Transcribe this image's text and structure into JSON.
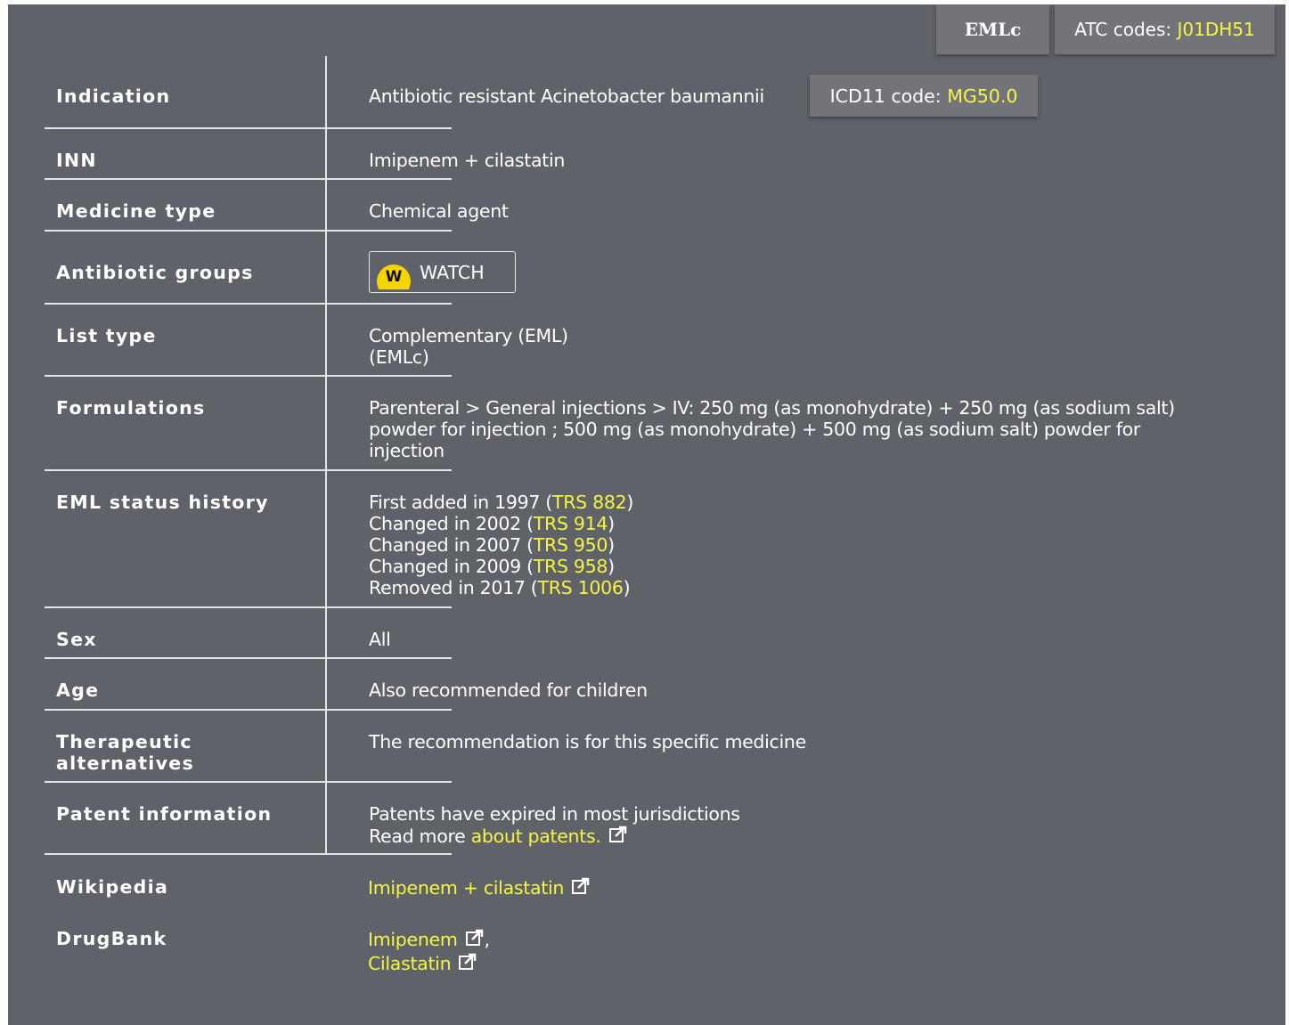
{
  "header": {
    "list_badge": "EMLc",
    "atc_label": "ATC codes: ",
    "atc_code": "J01DH51"
  },
  "rows": {
    "indication": {
      "label": "Indication",
      "value": "Antibiotic resistant Acinetobacter baumannii",
      "icd_label": "ICD11 code: ",
      "icd_code": "MG50.0"
    },
    "inn": {
      "label": "INN",
      "value": "Imipenem + cilastatin"
    },
    "medicine_type": {
      "label": "Medicine type",
      "value": "Chemical agent"
    },
    "antibiotic_groups": {
      "label": "Antibiotic groups",
      "badge_letter": "W",
      "badge_text": "WATCH",
      "badge_color": "#f5d400"
    },
    "list_type": {
      "label": "List type",
      "line1": "Complementary (EML)",
      "line2": "(EMLc)"
    },
    "formulations": {
      "label": "Formulations",
      "line1": "Parenteral > General injections > IV: 250 mg (as monohydrate) + 250 mg (as sodium salt)",
      "line2": "powder for injection ; 500 mg (as monohydrate) + 500 mg (as sodium salt) powder for",
      "line3": "injection"
    },
    "status_history": {
      "label": "EML status history",
      "entries": [
        {
          "text": "First added in 1997 (",
          "trs": "TRS 882",
          "close": ")"
        },
        {
          "text": "Changed in 2002 (",
          "trs": "TRS 914",
          "close": ")"
        },
        {
          "text": "Changed in 2007 (",
          "trs": "TRS 950",
          "close": ")"
        },
        {
          "text": "Changed in 2009 (",
          "trs": "TRS 958",
          "close": ")"
        },
        {
          "text": "Removed in 2017 (",
          "trs": "TRS 1006",
          "close": ")"
        }
      ]
    },
    "sex": {
      "label": "Sex",
      "value": "All"
    },
    "age": {
      "label": "Age",
      "value": "Also recommended for children"
    },
    "therapeutic": {
      "label_line1": "Therapeutic",
      "label_line2": "alternatives",
      "value": "The recommendation is for this specific medicine"
    },
    "patent": {
      "label": "Patent information",
      "line1": "Patents have expired in most jurisdictions",
      "read_more": "Read more ",
      "link": "about patents."
    },
    "wikipedia": {
      "label": "Wikipedia",
      "link": "Imipenem + cilastatin"
    },
    "drugbank": {
      "label": "DrugBank",
      "link1": "Imipenem",
      "sep": ",",
      "link2": "Cilastatin"
    }
  },
  "colors": {
    "panel": "#5f6269",
    "badge": "#737479",
    "link": "#f5f542",
    "watch": "#f5d400"
  },
  "icons": {
    "external": "external-link-icon",
    "watch": "watch-badge-icon"
  }
}
